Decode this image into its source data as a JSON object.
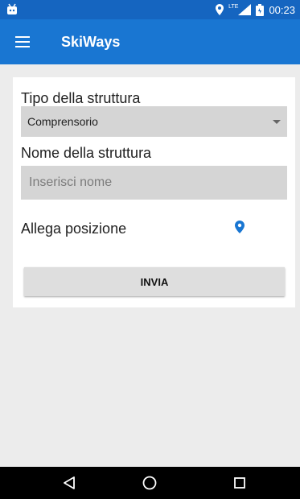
{
  "statusbar": {
    "time": "00:23",
    "network": "LTE"
  },
  "appbar": {
    "title": "SkiWays"
  },
  "form": {
    "type_label": "Tipo della struttura",
    "type_value": "Comprensorio",
    "name_label": "Nome della struttura",
    "name_placeholder": "Inserisci nome",
    "location_label": "Allega posizione",
    "submit_label": "INVIA"
  },
  "colors": {
    "statusbar": "#1565c0",
    "appbar": "#1976d2",
    "accent": "#1976d2"
  },
  "icons": {
    "menu": "hamburger-menu-icon",
    "location": "map-marker-icon",
    "back": "nav-back-icon",
    "home": "nav-home-icon",
    "recents": "nav-recents-icon"
  }
}
